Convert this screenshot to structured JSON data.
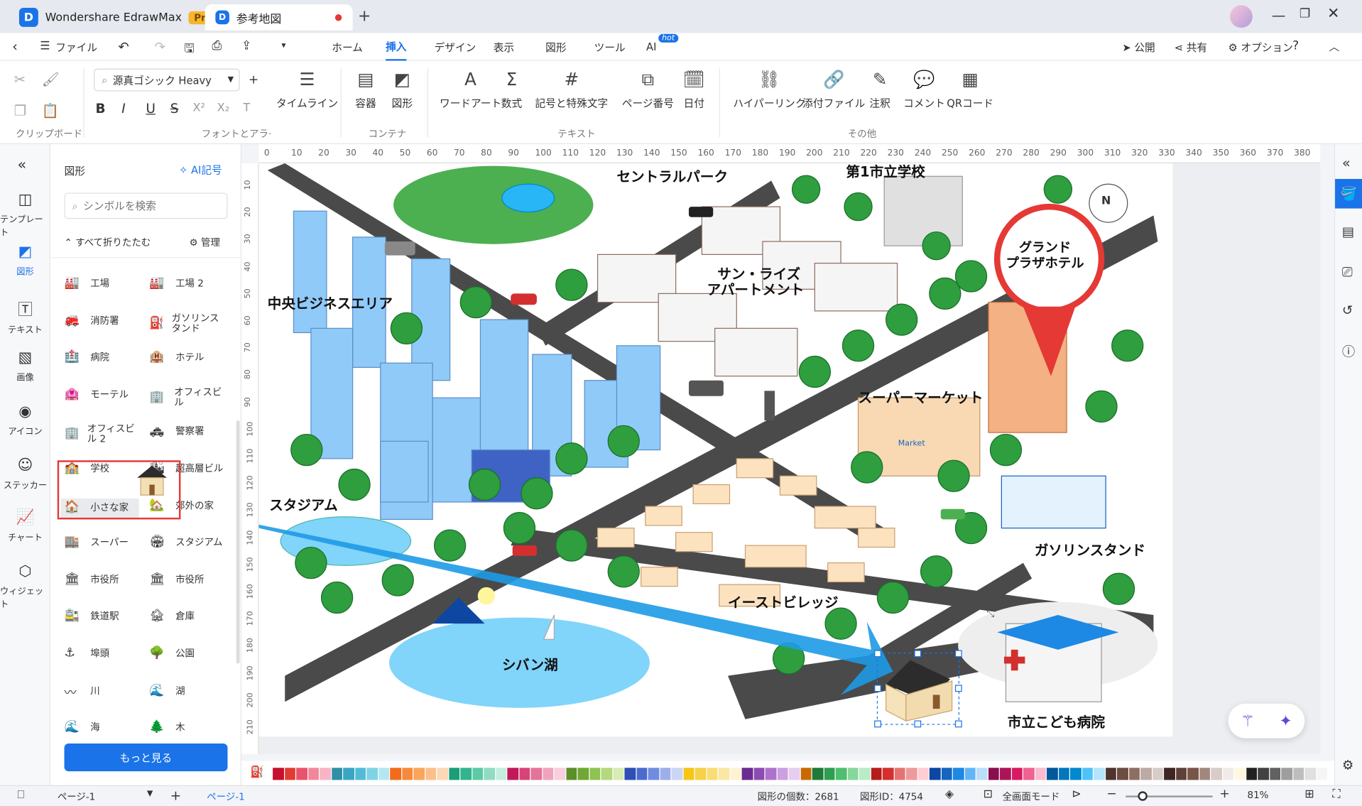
{
  "app": {
    "title": "Wondershare EdrawMax",
    "badge": "Pro",
    "doc_tab": "参考地図"
  },
  "menu": {
    "file": "ファイル",
    "items": [
      "ホーム",
      "挿入",
      "デザイン",
      "表示",
      "図形",
      "ツール",
      "AI"
    ],
    "hot": "hot",
    "publish": "公開",
    "share": "共有",
    "options": "オプション"
  },
  "ribbon": {
    "font_name": "源真ゴシック Heavy",
    "groups": {
      "clipboard": "クリップボード",
      "font": "フォントとアラ·",
      "container": "コンテナ",
      "text": "テキスト",
      "other": "その他"
    },
    "buttons": {
      "timeline": "タイムライン",
      "container": "容器",
      "shape": "図形",
      "wordart": "ワードアート",
      "formula": "数式",
      "symbol": "記号と特殊文字",
      "page_number": "ページ番号",
      "date": "日付",
      "hyperlink": "ハイパーリンク",
      "attachment": "添付ファイル",
      "note": "注釈",
      "comment": "コメント",
      "qr": "QRコード"
    }
  },
  "leftbar": [
    "テンプレート",
    "図形",
    "テキスト",
    "画像",
    "アイコン",
    "ステッカー",
    "チャート",
    "ウィジェット"
  ],
  "panel": {
    "title": "図形",
    "ai": "AI記号",
    "search_placeholder": "シンボルを検索",
    "collapse": "すべて折りたたむ",
    "manage": "管理",
    "more": "もっと見る",
    "shapes": [
      "工場",
      "工場 2",
      "消防署",
      "ガソリンスタンド",
      "病院",
      "ホテル",
      "モーテル",
      "オフィスビル",
      "オフィスビル 2",
      "警察署",
      "学校",
      "超高層ビル",
      "小さな家",
      "郊外の家",
      "スーパー",
      "スタジアム",
      "市役所",
      "市役所",
      "鉄道駅",
      "倉庫",
      "埠頭",
      "公園",
      "川",
      "湖",
      "海",
      "木"
    ]
  },
  "ruler": {
    "h": [
      "0",
      "10",
      "20",
      "30",
      "40",
      "50",
      "60",
      "70",
      "80",
      "90",
      "100",
      "110",
      "120",
      "130",
      "140",
      "150",
      "160",
      "170",
      "180",
      "190",
      "200",
      "210",
      "220",
      "230",
      "240",
      "250",
      "260",
      "270",
      "280",
      "290",
      "300",
      "310",
      "320",
      "330",
      "340",
      "350",
      "360",
      "370",
      "380"
    ],
    "v": [
      "10",
      "20",
      "30",
      "40",
      "50",
      "60",
      "70",
      "80",
      "90",
      "100",
      "110",
      "120",
      "130",
      "140",
      "150",
      "160",
      "170",
      "180",
      "190",
      "200",
      "210"
    ]
  },
  "map": {
    "central_park": "セントラルパーク",
    "school": "第1市立学校",
    "sunrise": "サン・ライズ",
    "apartment": "アパートメント",
    "cbd": "中央ビジネスエリア",
    "hotel1": "グランド",
    "hotel2": "プラザホテル",
    "supermarket": "スーパーマーケット",
    "stadium": "スタジアム",
    "gas": "ガソリンスタンド",
    "village": "イーストビレッジ",
    "lake": "シバン湖",
    "hospital": "市立こども病院",
    "compass": "N",
    "market_sign": "Market"
  },
  "status": {
    "page_sel": "ページ-1",
    "page_tab": "ページ-1",
    "shape_count": "図形の個数：2681",
    "shape_id": "図形ID：4754",
    "fullscreen": "全画面モード",
    "zoom": "81%"
  },
  "colors": [
    "#c8102e",
    "#e03c31",
    "#e8546e",
    "#f4869c",
    "#f9b4c4",
    "#2f8fa6",
    "#3aa6c4",
    "#52bcd6",
    "#7fd3e6",
    "#b2e7f1",
    "#f26b1d",
    "#f68a3c",
    "#f9a65c",
    "#fbc08a",
    "#fdd8b5",
    "#1b9e77",
    "#32b58e",
    "#5cc9a7",
    "#8fdcc3",
    "#c2eddf",
    "#c2185b",
    "#d6447a",
    "#e57399",
    "#f0a3bb",
    "#f8cfdc",
    "#5a8f29",
    "#6fa834",
    "#8fc24f",
    "#b4d87e",
    "#d8ecb3",
    "#2e4fb3",
    "#4a6ccf",
    "#6f8de0",
    "#9daeea",
    "#cbd5f4",
    "#f5c518",
    "#f7d14a",
    "#f9dc76",
    "#fbe7a4",
    "#fdf3d1",
    "#6a2c91",
    "#8c4bb3",
    "#ad73cc",
    "#cc9fe0",
    "#e7cdf0",
    "#c96a00",
    "#1f7a3a",
    "#2e9e4f",
    "#4fbf6d",
    "#85d79a",
    "#b9ebc6",
    "#b71c1c",
    "#d32f2f",
    "#e57373",
    "#ef9a9a",
    "#ffcdd2",
    "#0d47a1",
    "#1565c0",
    "#1e88e5",
    "#64b5f6",
    "#bbdefb",
    "#880e4f",
    "#ad1457",
    "#d81b60",
    "#f06292",
    "#f8bbd0",
    "#01579b",
    "#0277bd",
    "#0288d1",
    "#4fc3f7",
    "#b3e5fc",
    "#4e342e",
    "#6d4c41",
    "#8d6e63",
    "#bcaaa4",
    "#d7ccc8",
    "#3e2723",
    "#5d4037",
    "#795548",
    "#a1887f",
    "#d7ccc8",
    "#efebe9",
    "#fff8e1",
    "#212121",
    "#424242",
    "#616161",
    "#9e9e9e",
    "#bdbdbd",
    "#e0e0e0",
    "#f5f5f5"
  ]
}
